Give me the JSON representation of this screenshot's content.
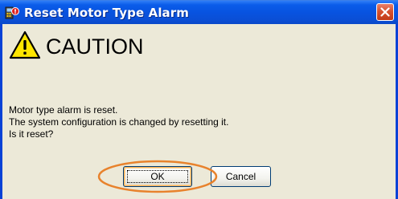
{
  "window": {
    "title": "Reset Motor Type Alarm",
    "app_icon": "alarm-reset-icon",
    "close_icon": "close-icon"
  },
  "dialog": {
    "caution_icon": "warning-triangle-icon",
    "heading": "CAUTION",
    "message_lines": [
      "Motor type alarm is reset.",
      "The system configuration is changed by resetting it.",
      "Is it reset?"
    ]
  },
  "buttons": {
    "ok_label": "OK",
    "cancel_label": "Cancel"
  },
  "colors": {
    "titlebar": "#0853e0",
    "window_background": "#ece9d8",
    "close_button": "#d6522f",
    "highlight_oval": "#e8822c",
    "caution_yellow": "#ffe600"
  }
}
